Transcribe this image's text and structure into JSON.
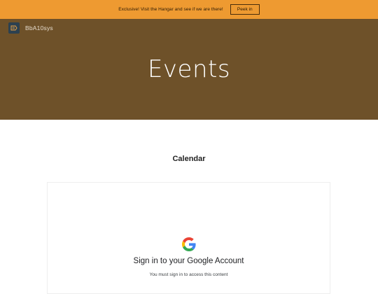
{
  "promo": {
    "message": "Exclusive! Visit the Hangar and see if we are there!",
    "button_label": "Peek in"
  },
  "header": {
    "site_name": "BbA10sys",
    "logo_icon": "tag-logo-icon"
  },
  "hero": {
    "title": "Events"
  },
  "section": {
    "title": "Calendar"
  },
  "calendar_embed": {
    "signin_title": "Sign in to your Google Account",
    "signin_subtitle": "You must sign in to access this content",
    "logo_icon": "google-g-icon"
  },
  "colors": {
    "promo_bg": "#ee9a31",
    "hero_bg": "#6e5129",
    "logo_bg": "#2c4150"
  }
}
